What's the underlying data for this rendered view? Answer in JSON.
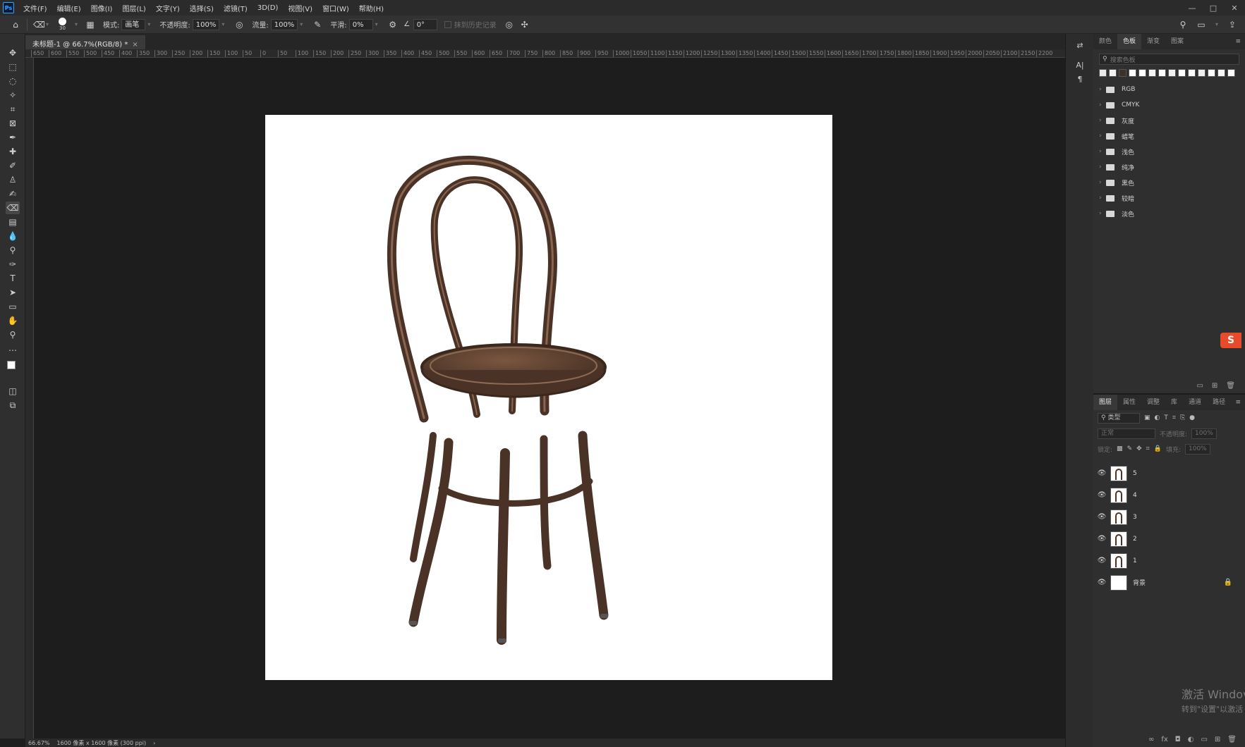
{
  "menubar": {
    "items": [
      "文件(F)",
      "编辑(E)",
      "图像(I)",
      "图层(L)",
      "文字(Y)",
      "选择(S)",
      "滤镜(T)",
      "3D(D)",
      "视图(V)",
      "窗口(W)",
      "帮助(H)"
    ],
    "controls": [
      "—",
      "□",
      "✕"
    ]
  },
  "options": {
    "brush_size": "30",
    "mode_label": "模式:",
    "mode_value": "画笔",
    "opacity_label": "不透明度:",
    "opacity_value": "100%",
    "flow_label": "流量:",
    "flow_value": "100%",
    "smooth_label": "平滑:",
    "smooth_value": "0%",
    "angle_value": "0°",
    "erase_history_label": "抹到历史记录"
  },
  "document_tab": {
    "title": "未标题-1 @ 66.7%(RGB/8) *",
    "close": "×"
  },
  "ruler": {
    "ticks": [
      "650",
      "600",
      "550",
      "500",
      "450",
      "400",
      "350",
      "300",
      "250",
      "200",
      "150",
      "100",
      "50",
      "0",
      "50",
      "100",
      "150",
      "200",
      "250",
      "300",
      "350",
      "400",
      "450",
      "500",
      "550",
      "600",
      "650",
      "700",
      "750",
      "800",
      "850",
      "900",
      "950",
      "1000",
      "1050",
      "1100",
      "1150",
      "1200",
      "1250",
      "1300",
      "1350",
      "1400",
      "1450",
      "1500",
      "1550",
      "1600",
      "1650",
      "1700",
      "1750",
      "1800",
      "1850",
      "1900",
      "1950",
      "2000",
      "2050",
      "2100",
      "2150",
      "2200"
    ]
  },
  "swatches_panel": {
    "tabs": [
      "颜色",
      "色板",
      "渐变",
      "图案"
    ],
    "active_tab": "色板",
    "search_placeholder": "搜索色板",
    "recent_colors": [
      "#e8e8e8",
      "#f2f2f2",
      "#3a3128",
      "#ffffff",
      "#ffffff",
      "#f5f5f5",
      "#ffffff",
      "#f0f0f0",
      "#ffffff",
      "#ffffff",
      "#eeeeee",
      "#ffffff",
      "#f7f7f7",
      "#ffffff"
    ],
    "folders": [
      "RGB",
      "CMYK",
      "灰度",
      "蜡笔",
      "浅色",
      "纯净",
      "黑色",
      "较暗",
      "淡色"
    ]
  },
  "layers_panel": {
    "tabs": [
      "图层",
      "属性",
      "调整",
      "库",
      "通道",
      "路径"
    ],
    "active_tab": "图层",
    "filter_label": "类型",
    "blend_mode": "正常",
    "opacity_label": "不透明度:",
    "opacity_value": "100%",
    "lock_label": "锁定:",
    "fill_label": "填充:",
    "fill_value": "100%",
    "layers": [
      {
        "name": "5",
        "locked": false
      },
      {
        "name": "4",
        "locked": false
      },
      {
        "name": "3",
        "locked": false
      },
      {
        "name": "2",
        "locked": false
      },
      {
        "name": "1",
        "locked": false
      },
      {
        "name": "背景",
        "locked": true
      }
    ]
  },
  "status": {
    "zoom": "66.67%",
    "doc_info": "1600 像素 x 1600 像素 (300 ppi)",
    "arrow": "›"
  },
  "watermark": {
    "line1": "激活 Windov",
    "line2": "转到\"设置\"以激活"
  },
  "ime_badge": "S"
}
